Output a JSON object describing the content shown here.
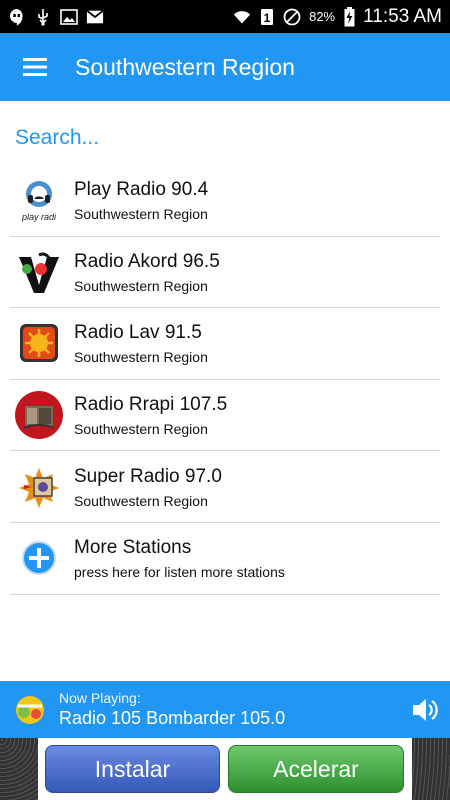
{
  "status_bar": {
    "battery": "82%",
    "time": "11:53 AM",
    "network_badge": "1"
  },
  "app_bar": {
    "title": "Southwestern Region",
    "menu_icon": "hamburger-menu-icon"
  },
  "search": {
    "placeholder": "Search...",
    "value": ""
  },
  "stations": [
    {
      "name": "Play Radio 90.4",
      "region": "Southwestern Region",
      "logo_text": "play radi"
    },
    {
      "name": "Radio Akord 96.5",
      "region": "Southwestern Region"
    },
    {
      "name": "Radio Lav 91.5",
      "region": "Southwestern Region"
    },
    {
      "name": "Radio Rrapi 107.5",
      "region": "Southwestern Region"
    },
    {
      "name": "Super Radio 97.0",
      "region": "Southwestern Region"
    },
    {
      "name": "More Stations",
      "region": "press here for listen more stations"
    }
  ],
  "now_playing": {
    "label": "Now Playing:",
    "station": "Radio 105 Bombarder 105.0"
  },
  "ad": {
    "install_label": "Instalar",
    "accelerate_label": "Acelerar"
  },
  "colors": {
    "primary": "#2196f3",
    "install": "#3f66c8",
    "accelerate": "#3aa53a"
  }
}
